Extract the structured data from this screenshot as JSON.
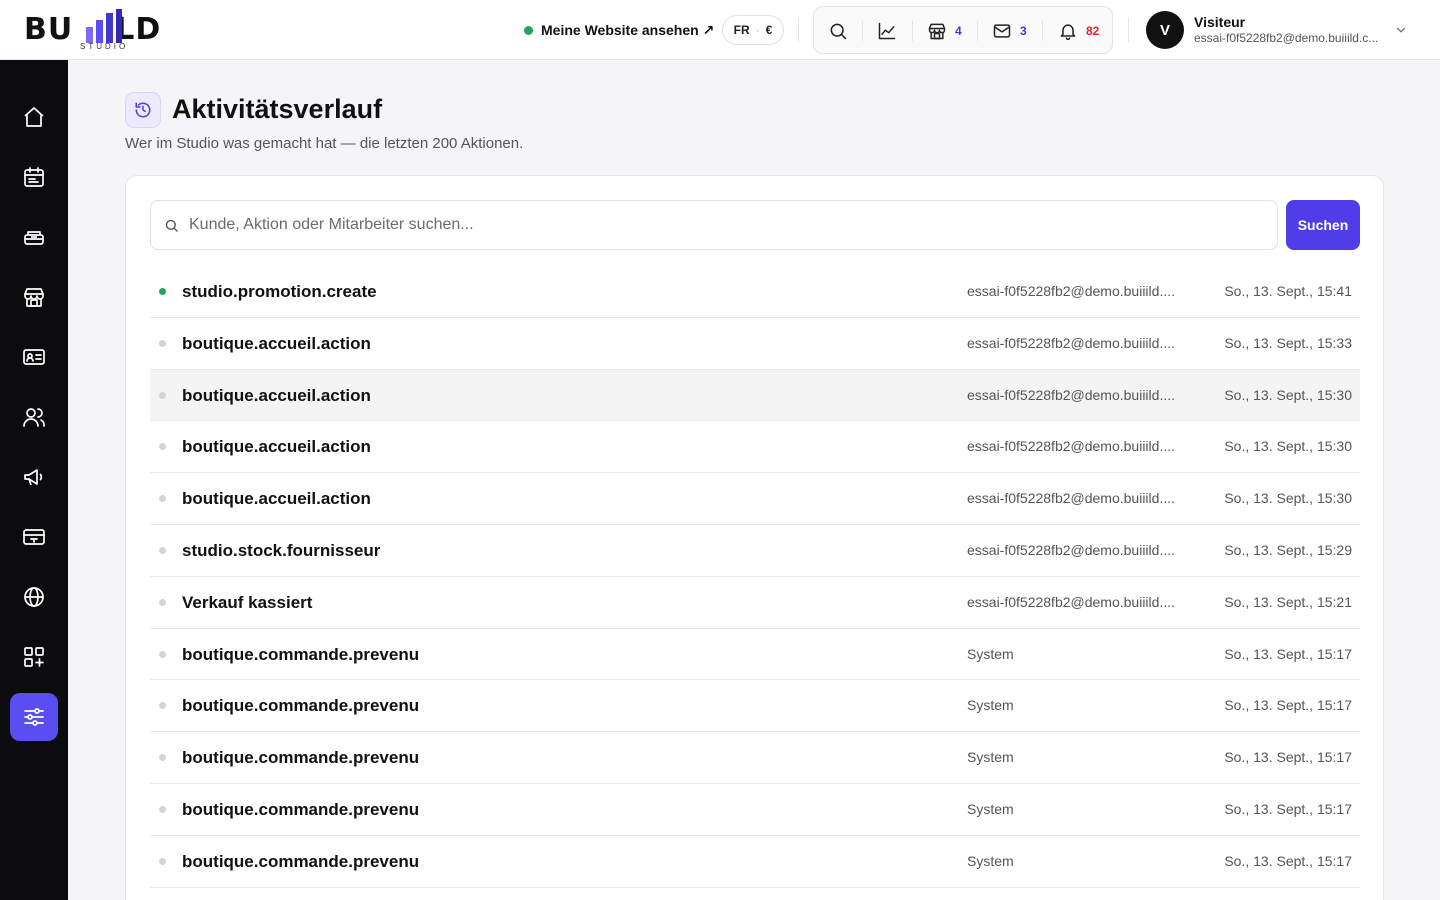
{
  "brand": {
    "logo_text_left": "BU",
    "logo_text_right": "LD",
    "logo_sub": "STUDIO"
  },
  "header": {
    "site_link_label": "Meine Website ansehen ↗",
    "lang": "FR",
    "currency": "€",
    "tools": {
      "store_count": "4",
      "mail_count": "3",
      "notif_count": "82"
    },
    "user": {
      "initial": "V",
      "name": "Visiteur",
      "email": "essai-f0f5228fb2@demo.buiiild.c..."
    }
  },
  "sidebar": {
    "items": [
      "home-icon",
      "calendar-icon",
      "inventory-icon",
      "store-icon",
      "contact-card-icon",
      "users-icon",
      "megaphone-icon",
      "payment-card-icon",
      "globe-icon",
      "apps-add-icon",
      "settings-sliders-icon"
    ],
    "active": "settings-sliders-icon"
  },
  "page": {
    "title": "Aktivitätsverlauf",
    "subtitle": "Wer im Studio was gemacht hat — die letzten 200 Aktionen."
  },
  "search": {
    "placeholder": "Kunde, Aktion oder Mitarbeiter suchen...",
    "value": "",
    "button_label": "Suchen"
  },
  "activity": [
    {
      "action": "studio.promotion.create",
      "actor": "essai-f0f5228fb2@demo.buiiild....",
      "time": "So., 13. Sept., 15:41",
      "status": "green"
    },
    {
      "action": "boutique.accueil.action",
      "actor": "essai-f0f5228fb2@demo.buiiild....",
      "time": "So., 13. Sept., 15:33",
      "status": "grey"
    },
    {
      "action": "boutique.accueil.action",
      "actor": "essai-f0f5228fb2@demo.buiiild....",
      "time": "So., 13. Sept., 15:30",
      "status": "grey",
      "highlighted": true
    },
    {
      "action": "boutique.accueil.action",
      "actor": "essai-f0f5228fb2@demo.buiiild....",
      "time": "So., 13. Sept., 15:30",
      "status": "grey"
    },
    {
      "action": "boutique.accueil.action",
      "actor": "essai-f0f5228fb2@demo.buiiild....",
      "time": "So., 13. Sept., 15:30",
      "status": "grey"
    },
    {
      "action": "studio.stock.fournisseur",
      "actor": "essai-f0f5228fb2@demo.buiiild....",
      "time": "So., 13. Sept., 15:29",
      "status": "grey"
    },
    {
      "action": "Verkauf kassiert",
      "actor": "essai-f0f5228fb2@demo.buiiild....",
      "time": "So., 13. Sept., 15:21",
      "status": "grey"
    },
    {
      "action": "boutique.commande.prevenu",
      "actor": "System",
      "time": "So., 13. Sept., 15:17",
      "status": "grey"
    },
    {
      "action": "boutique.commande.prevenu",
      "actor": "System",
      "time": "So., 13. Sept., 15:17",
      "status": "grey"
    },
    {
      "action": "boutique.commande.prevenu",
      "actor": "System",
      "time": "So., 13. Sept., 15:17",
      "status": "grey"
    },
    {
      "action": "boutique.commande.prevenu",
      "actor": "System",
      "time": "So., 13. Sept., 15:17",
      "status": "grey"
    },
    {
      "action": "boutique.commande.prevenu",
      "actor": "System",
      "time": "So., 13. Sept., 15:17",
      "status": "grey"
    }
  ],
  "colors": {
    "accent": "#4f3ee8",
    "sidebar_bg": "#0c0c0e",
    "status_green": "#22a559",
    "notif_red": "#dc2626"
  }
}
